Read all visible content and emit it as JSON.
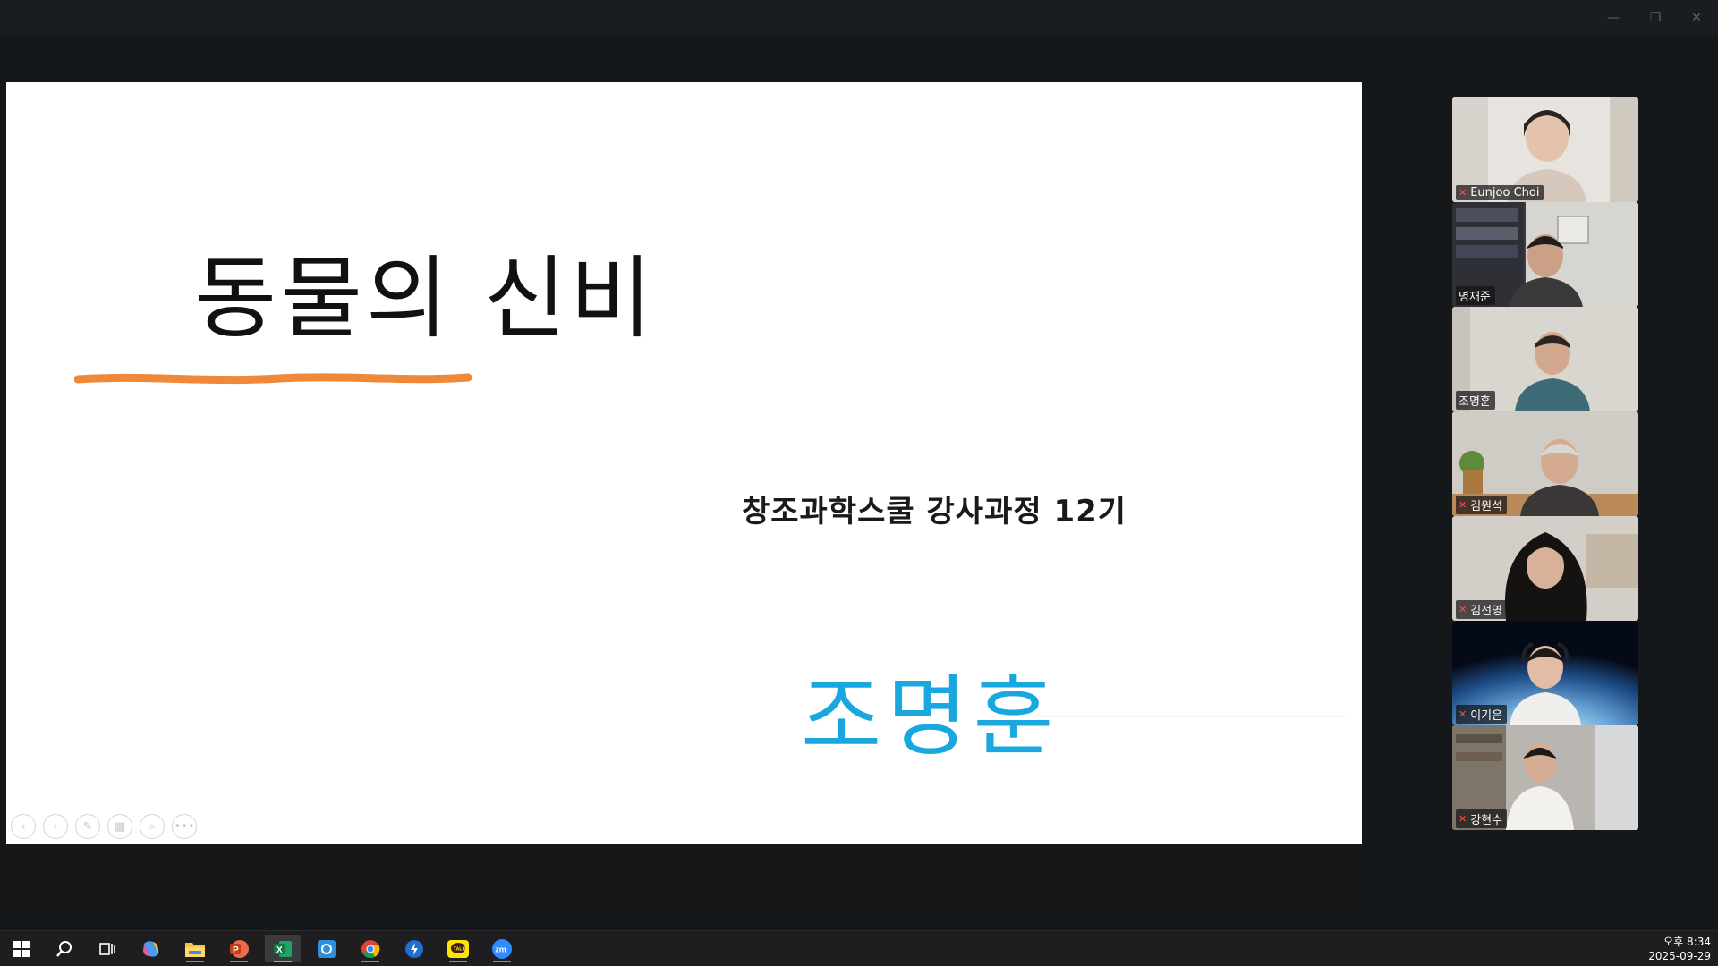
{
  "slide": {
    "title": "동물의 신비",
    "subtitle": "창조과학스쿨  강사과정 12기",
    "author": "조명훈"
  },
  "participants": [
    {
      "name": "Eunjoo Choi",
      "muted": true
    },
    {
      "name": "명재준",
      "muted": false
    },
    {
      "name": "조명훈",
      "muted": false
    },
    {
      "name": "김원석",
      "muted": true
    },
    {
      "name": "김선영",
      "muted": true
    },
    {
      "name": "이기은",
      "muted": true,
      "active_speaker": true
    },
    {
      "name": "강현수",
      "muted": true
    }
  ],
  "window_controls": {
    "minimize": "—",
    "restore": "❐",
    "close": "✕"
  },
  "slide_tools": [
    "previous-icon",
    "next-icon",
    "pen-icon",
    "slides-icon",
    "zoom-icon",
    "more-icon"
  ],
  "taskbar": {
    "apps": [
      "start-icon",
      "search-icon",
      "task-view-icon",
      "copilot-icon",
      "file-explorer-icon",
      "powerpoint-icon",
      "excel-icon",
      "hangul-icon",
      "chrome-icon",
      "messenger-icon",
      "kakaotalk-icon",
      "zoom-icon"
    ],
    "time": "오후 8:34",
    "date": "2025-09-29"
  },
  "colors": {
    "accent_orange": "#f0883a",
    "author_blue": "#1aa7e0",
    "active_speaker_green": "#29c57a"
  }
}
